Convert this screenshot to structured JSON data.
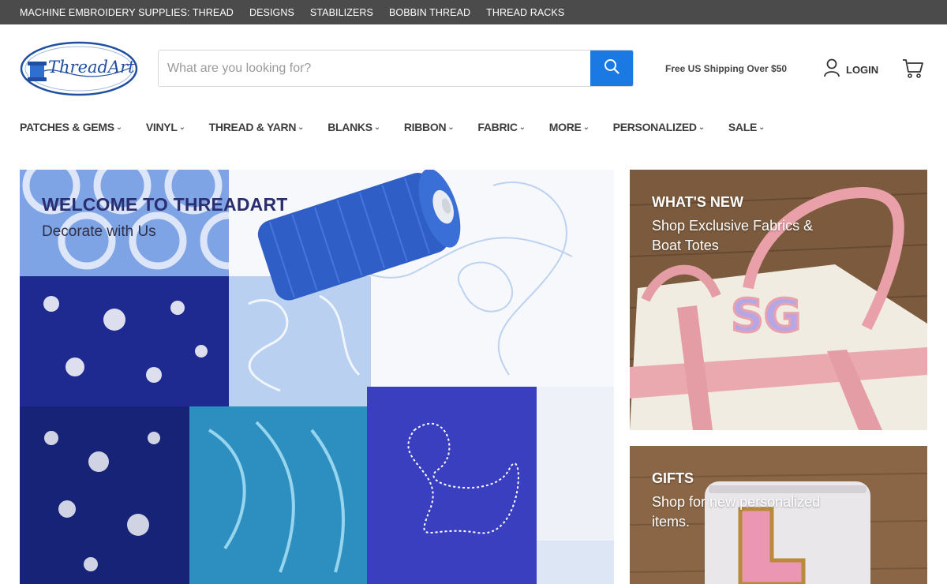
{
  "topbar": {
    "links": [
      "MACHINE EMBROIDERY SUPPLIES: THREAD",
      "DESIGNS",
      "STABILIZERS",
      "BOBBIN THREAD",
      "THREAD RACKS"
    ]
  },
  "header": {
    "logo_text": "ThreadArt",
    "search_placeholder": "What are you looking for?",
    "shipping": "Free US Shipping Over $50",
    "login_label": "LOGIN"
  },
  "nav": {
    "items": [
      "PATCHES & GEMS",
      "VINYL",
      "THREAD & YARN",
      "BLANKS",
      "RIBBON",
      "FABRIC",
      "MORE",
      "PERSONALIZED",
      "SALE"
    ]
  },
  "hero": {
    "title": "WELCOME TO THREADART",
    "subtitle": "Decorate with Us"
  },
  "promos": [
    {
      "title": "WHAT'S NEW",
      "subtitle": "Shop Exclusive Fabrics & Boat Totes"
    },
    {
      "title": "GIFTS",
      "subtitle": "Shop for new personalized items."
    }
  ],
  "colors": {
    "topbar_bg": "#4b4b4b",
    "search_button": "#1a79e3",
    "hero_title": "#2a2d6e"
  }
}
